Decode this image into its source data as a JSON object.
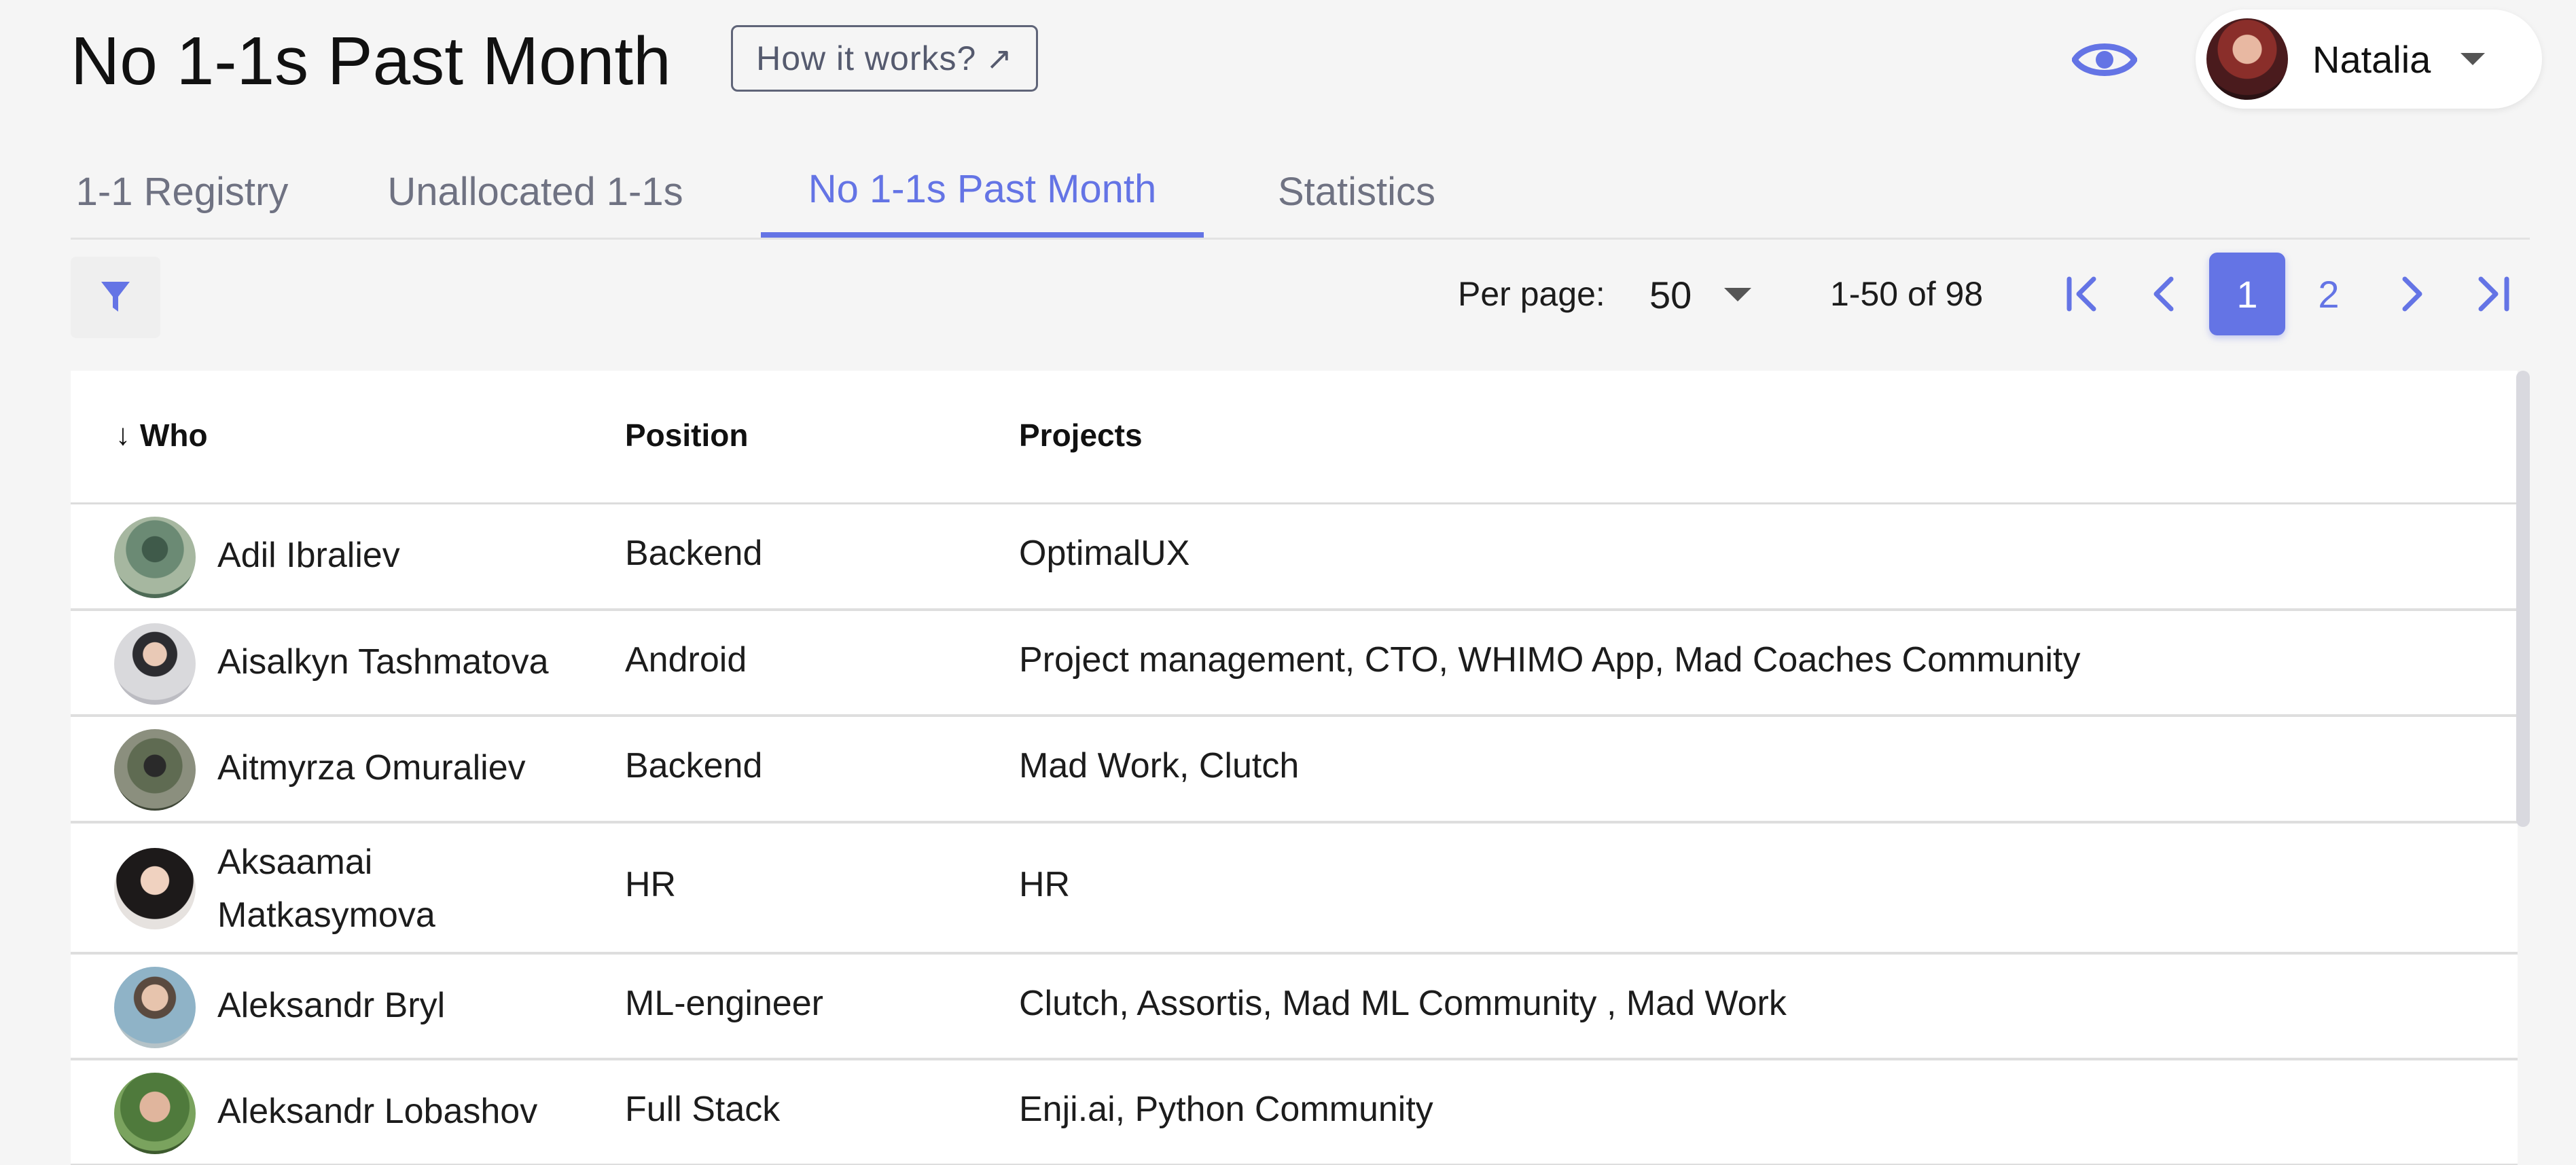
{
  "header": {
    "title": "No 1-1s Past Month",
    "how_it_works_label": "How it works?",
    "external_link_glyph": "↗",
    "user_name": "Natalia"
  },
  "tabs": [
    {
      "label": "1-1 Registry",
      "active": false
    },
    {
      "label": "Unallocated 1-1s",
      "active": false
    },
    {
      "label": "No 1-1s Past Month",
      "active": true
    },
    {
      "label": "Statistics",
      "active": false
    }
  ],
  "toolbar": {
    "per_page_label": "Per page:",
    "per_page_value": "50",
    "range_text": "1-50 of 98",
    "pages": [
      "1",
      "2"
    ],
    "current_page": "1"
  },
  "table": {
    "sort_glyph": "↓",
    "columns": [
      "Who",
      "Position",
      "Projects"
    ],
    "rows": [
      {
        "who": "Adil Ibraliev",
        "position": "Backend",
        "projects": "OptimalUX"
      },
      {
        "who": "Aisalkyn Tashmatova",
        "position": "Android",
        "projects": "Project management, CTO, WHIMO App, Mad Coaches Community"
      },
      {
        "who": "Aitmyrza Omuraliev",
        "position": "Backend",
        "projects": "Mad Work, Clutch"
      },
      {
        "who": "Aksaamai Matkasymova",
        "position": "HR",
        "projects": "HR"
      },
      {
        "who": "Aleksandr Bryl",
        "position": "ML-engineer",
        "projects": "Clutch, Assortis, Mad ML Community , Mad Work"
      },
      {
        "who": "Aleksandr Lobashov",
        "position": "Full Stack",
        "projects": "Enji.ai, Python Community"
      }
    ]
  },
  "colors": {
    "accent": "#6474e5",
    "background": "#f5f5f5",
    "card": "#ffffff",
    "tab_inactive": "#6f7282"
  },
  "icons": [
    "external-link-icon",
    "eye-icon",
    "chevron-down-icon",
    "filter-icon",
    "first-page-icon",
    "prev-page-icon",
    "next-page-icon",
    "last-page-icon",
    "sort-down-icon"
  ]
}
